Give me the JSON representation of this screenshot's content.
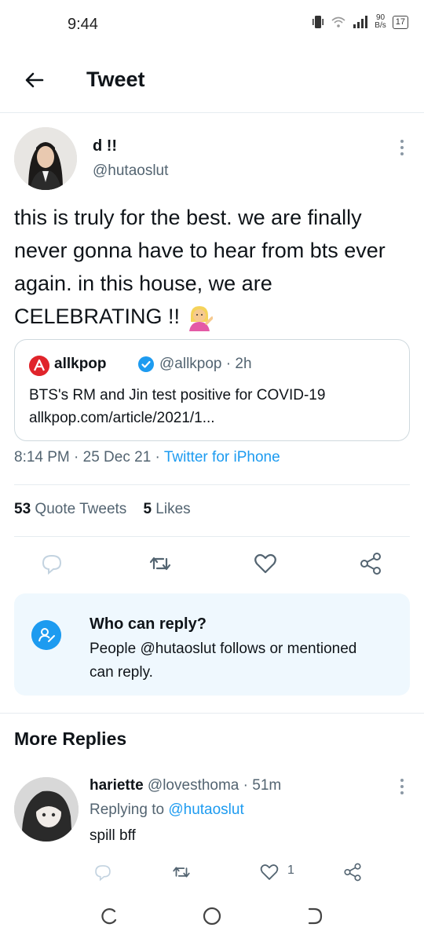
{
  "status": {
    "time": "9:44",
    "net_speed_value": "90",
    "net_speed_unit": "B/s",
    "battery": "17"
  },
  "header": {
    "title": "Tweet"
  },
  "tweet": {
    "display_name": "d !!",
    "handle": "@hutaoslut",
    "text": "this is truly for the best. we are finally never gonna have to hear from bts ever again. in this house, we are CELEBRATING !!",
    "emoji": "woman-tipping-hand-emoji",
    "quote": {
      "name": "allkpop",
      "meta": "@allkpop · 2h",
      "text_line1": "BTS's RM and Jin test positive for COVID-19",
      "text_line2": "allkpop.com/article/2021/1..."
    },
    "timestamp": "8:14 PM · 25 Dec 21 · ",
    "source": "Twitter for iPhone",
    "quote_tweets_count": "53",
    "quote_tweets_label": "Quote Tweets",
    "likes_count": "5",
    "likes_label": "Likes"
  },
  "who_can_reply": {
    "title": "Who can reply?",
    "body": "People @hutaoslut follows or mentioned can reply."
  },
  "more_replies": {
    "heading": "More Replies"
  },
  "reply": {
    "name": "hariette",
    "meta": "@lovesthoma · 51m",
    "replying_prefix": "Replying to ",
    "replying_handle": "@hutaoslut",
    "text": "spill bff",
    "like_count": "1"
  },
  "colors": {
    "accent": "#1d9bf0",
    "secondary_text": "#536471",
    "who_card_bg": "#eff8fe",
    "allkpop_red": "#e0242b"
  },
  "icons": {
    "back": "back-arrow-icon",
    "more": "more-vertical-icon",
    "reply": "reply-icon",
    "retweet": "retweet-icon",
    "like": "heart-icon",
    "share": "share-icon",
    "verified": "verified-badge-icon",
    "who_reply": "mention-icon"
  }
}
